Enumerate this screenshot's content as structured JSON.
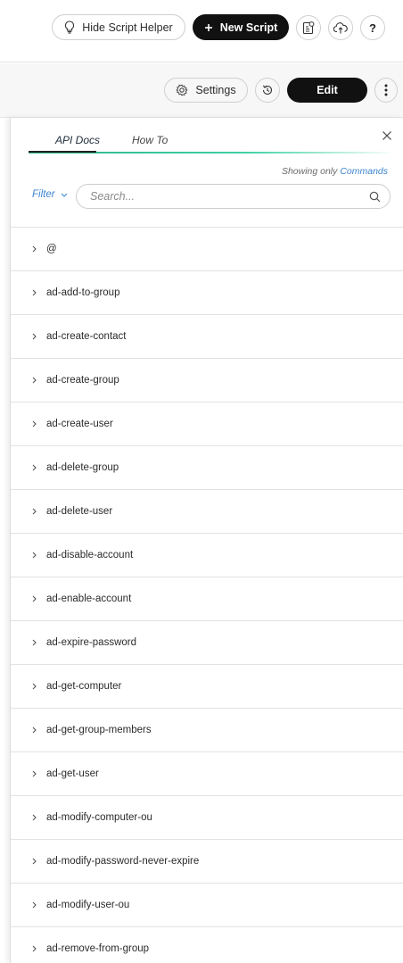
{
  "toolbar": {
    "hide_helper_label": "Hide Script Helper",
    "new_script_label": "New Script",
    "help_label": "?"
  },
  "subbar": {
    "settings_label": "Settings",
    "edit_label": "Edit"
  },
  "panel": {
    "tabs": [
      {
        "label": "API Docs",
        "active": true
      },
      {
        "label": "How To",
        "active": false
      }
    ],
    "showing_prefix": "Showing only ",
    "showing_link": "Commands",
    "filter_label": "Filter",
    "search_placeholder": "Search...",
    "items": [
      "@",
      "ad-add-to-group",
      "ad-create-contact",
      "ad-create-group",
      "ad-create-user",
      "ad-delete-group",
      "ad-delete-user",
      "ad-disable-account",
      "ad-enable-account",
      "ad-expire-password",
      "ad-get-computer",
      "ad-get-group-members",
      "ad-get-user",
      "ad-modify-computer-ou",
      "ad-modify-password-never-expire",
      "ad-modify-user-ou",
      "ad-remove-from-group"
    ]
  },
  "colors": {
    "accent_link": "#3d84cf",
    "tab_underline": "#2fb58d",
    "dark_button": "#111111"
  },
  "icons": [
    "lightbulb-icon",
    "plus-icon",
    "clipboard-settings-icon",
    "cloud-upload-icon",
    "help-icon",
    "gear-icon",
    "history-icon",
    "more-vertical-icon",
    "close-icon",
    "chevron-down-icon",
    "search-icon",
    "chevron-right-icon"
  ]
}
